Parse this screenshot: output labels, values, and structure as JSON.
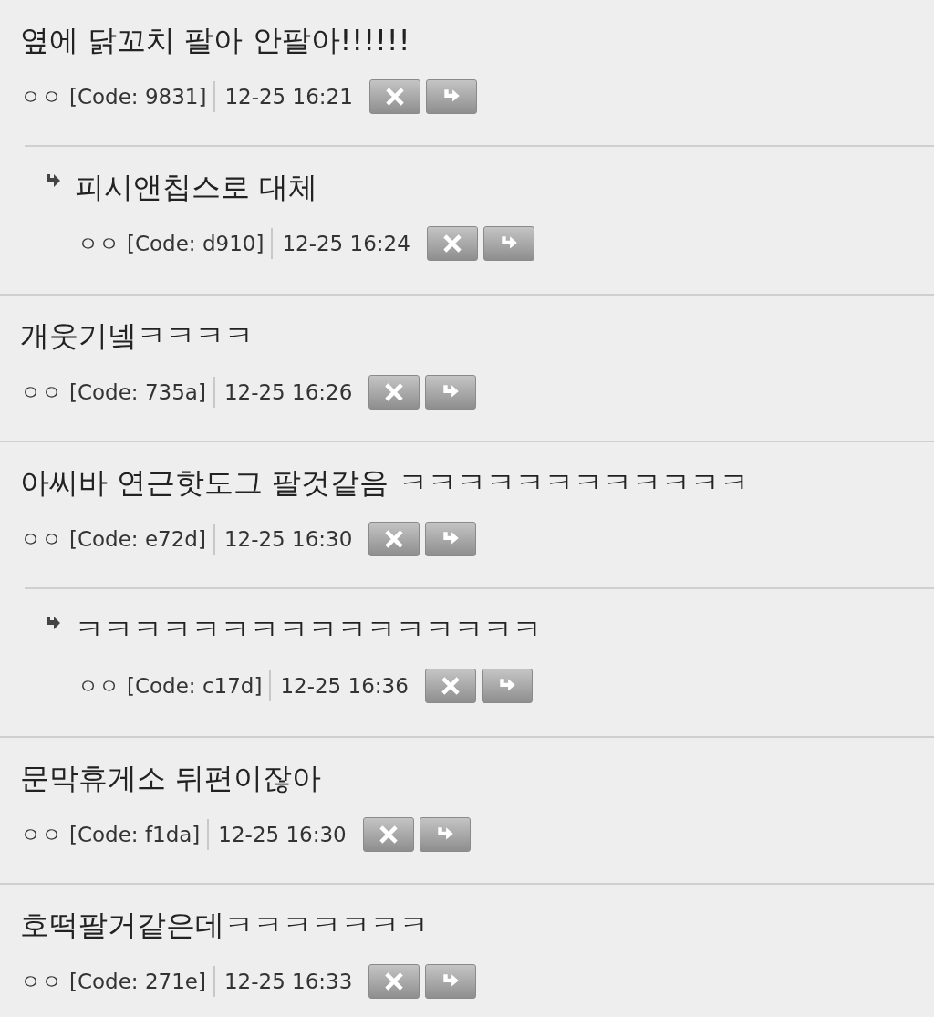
{
  "comments": [
    {
      "text": "옆에 닭꼬치 팔아 안팔아!!!!!!",
      "author": "ㅇㅇ",
      "code": "[Code: 9831]",
      "time": "12-25 16:21",
      "children": [
        {
          "text": "피시앤칩스로 대체",
          "author": "ㅇㅇ",
          "code": "[Code: d910]",
          "time": "12-25 16:24"
        }
      ]
    },
    {
      "text": "개웃기넼ㅋㅋㅋㅋ",
      "author": "ㅇㅇ",
      "code": "[Code: 735a]",
      "time": "12-25 16:26"
    },
    {
      "text": "아씨바 연근핫도그 팔것같음 ㅋㅋㅋㅋㅋㅋㅋㅋㅋㅋㅋㅋ",
      "author": "ㅇㅇ",
      "code": "[Code: e72d]",
      "time": "12-25 16:30",
      "children": [
        {
          "text": "ㅋㅋㅋㅋㅋㅋㅋㅋㅋㅋㅋㅋㅋㅋㅋㅋ",
          "author": "ㅇㅇ",
          "code": "[Code: c17d]",
          "time": "12-25 16:36"
        }
      ]
    },
    {
      "text": "문막휴게소 뒤편이잖아",
      "author": "ㅇㅇ",
      "code": "[Code: f1da]",
      "time": "12-25 16:30"
    },
    {
      "text": "호떡팔거같은데ㅋㅋㅋㅋㅋㅋㅋ",
      "author": "ㅇㅇ",
      "code": "[Code: 271e]",
      "time": "12-25 16:33"
    }
  ]
}
